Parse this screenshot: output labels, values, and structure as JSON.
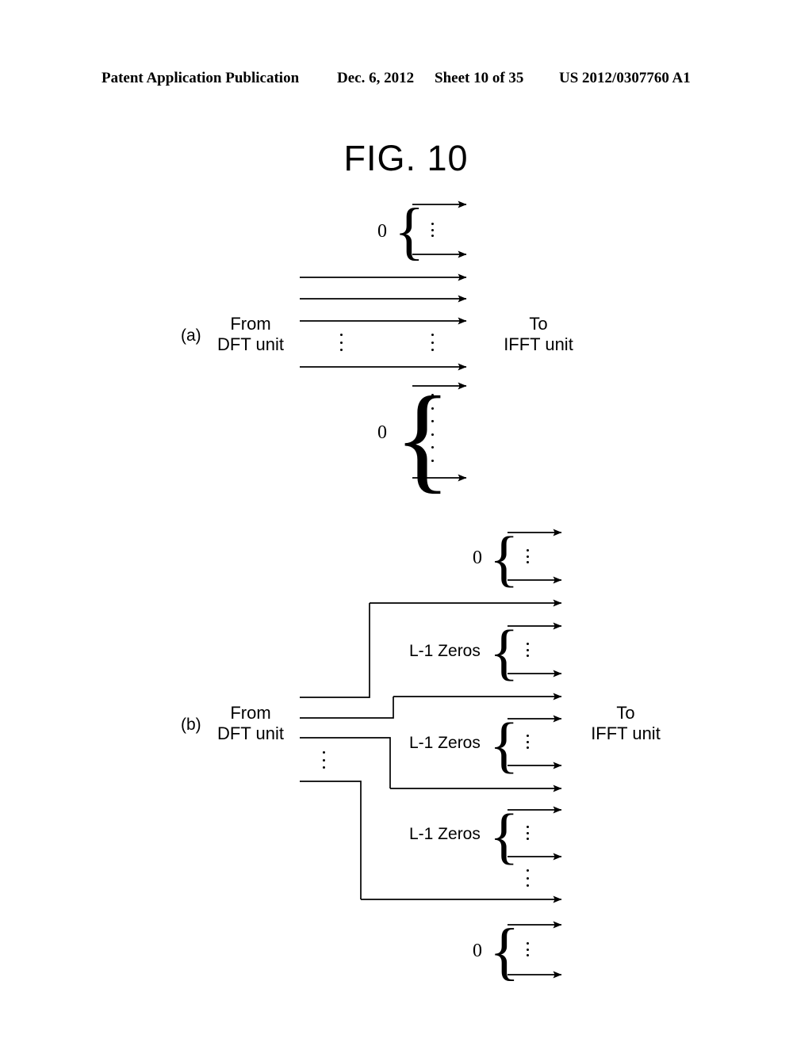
{
  "header": {
    "publication": "Patent Application Publication",
    "date": "Dec. 6, 2012",
    "sheet": "Sheet 10 of 35",
    "number": "US 2012/0307760 A1"
  },
  "figure": {
    "title": "FIG. 10"
  },
  "panels": [
    {
      "id": "a",
      "label": "(a)",
      "input_label": "From\nDFT unit",
      "input_label_line1": "From",
      "input_label_line2": "DFT unit",
      "output_label_line1": "To",
      "output_label_line2": "IFFT unit",
      "groups": [
        {
          "kind": "zero-block",
          "label": "0",
          "arrows": 2,
          "dots": 3
        },
        {
          "kind": "signal",
          "arrows": 3,
          "dots": 3
        },
        {
          "kind": "signal",
          "arrows": 1
        },
        {
          "kind": "zero-block",
          "label": "0",
          "arrows": 2,
          "dots": 6
        }
      ]
    },
    {
      "id": "b",
      "label": "(b)",
      "input_label_line1": "From",
      "input_label_line2": "DFT unit",
      "output_label_line1": "To",
      "output_label_line2": "IFFT unit",
      "zeros_label": "L-1 Zeros",
      "zero_label": "0",
      "groups": [
        {
          "kind": "zero-block",
          "label": "0",
          "arrows": 2,
          "dots": 3
        },
        {
          "kind": "signal",
          "arrows": 1
        },
        {
          "kind": "zeros-block",
          "label": "L-1 Zeros",
          "arrows": 2,
          "dots": 3
        },
        {
          "kind": "signal",
          "arrows": 1
        },
        {
          "kind": "zeros-block",
          "label": "L-1 Zeros",
          "arrows": 2,
          "dots": 3
        },
        {
          "kind": "signal",
          "arrows": 1
        },
        {
          "kind": "zeros-block",
          "label": "L-1 Zeros",
          "arrows": 2,
          "dots": 3
        },
        {
          "kind": "signal",
          "arrows": 1,
          "dots": 3
        },
        {
          "kind": "zero-block",
          "label": "0",
          "arrows": 2,
          "dots": 3
        }
      ],
      "inputs": 4,
      "input_dots": 3
    }
  ],
  "colors": {
    "ink": "#000000",
    "background": "#ffffff"
  }
}
